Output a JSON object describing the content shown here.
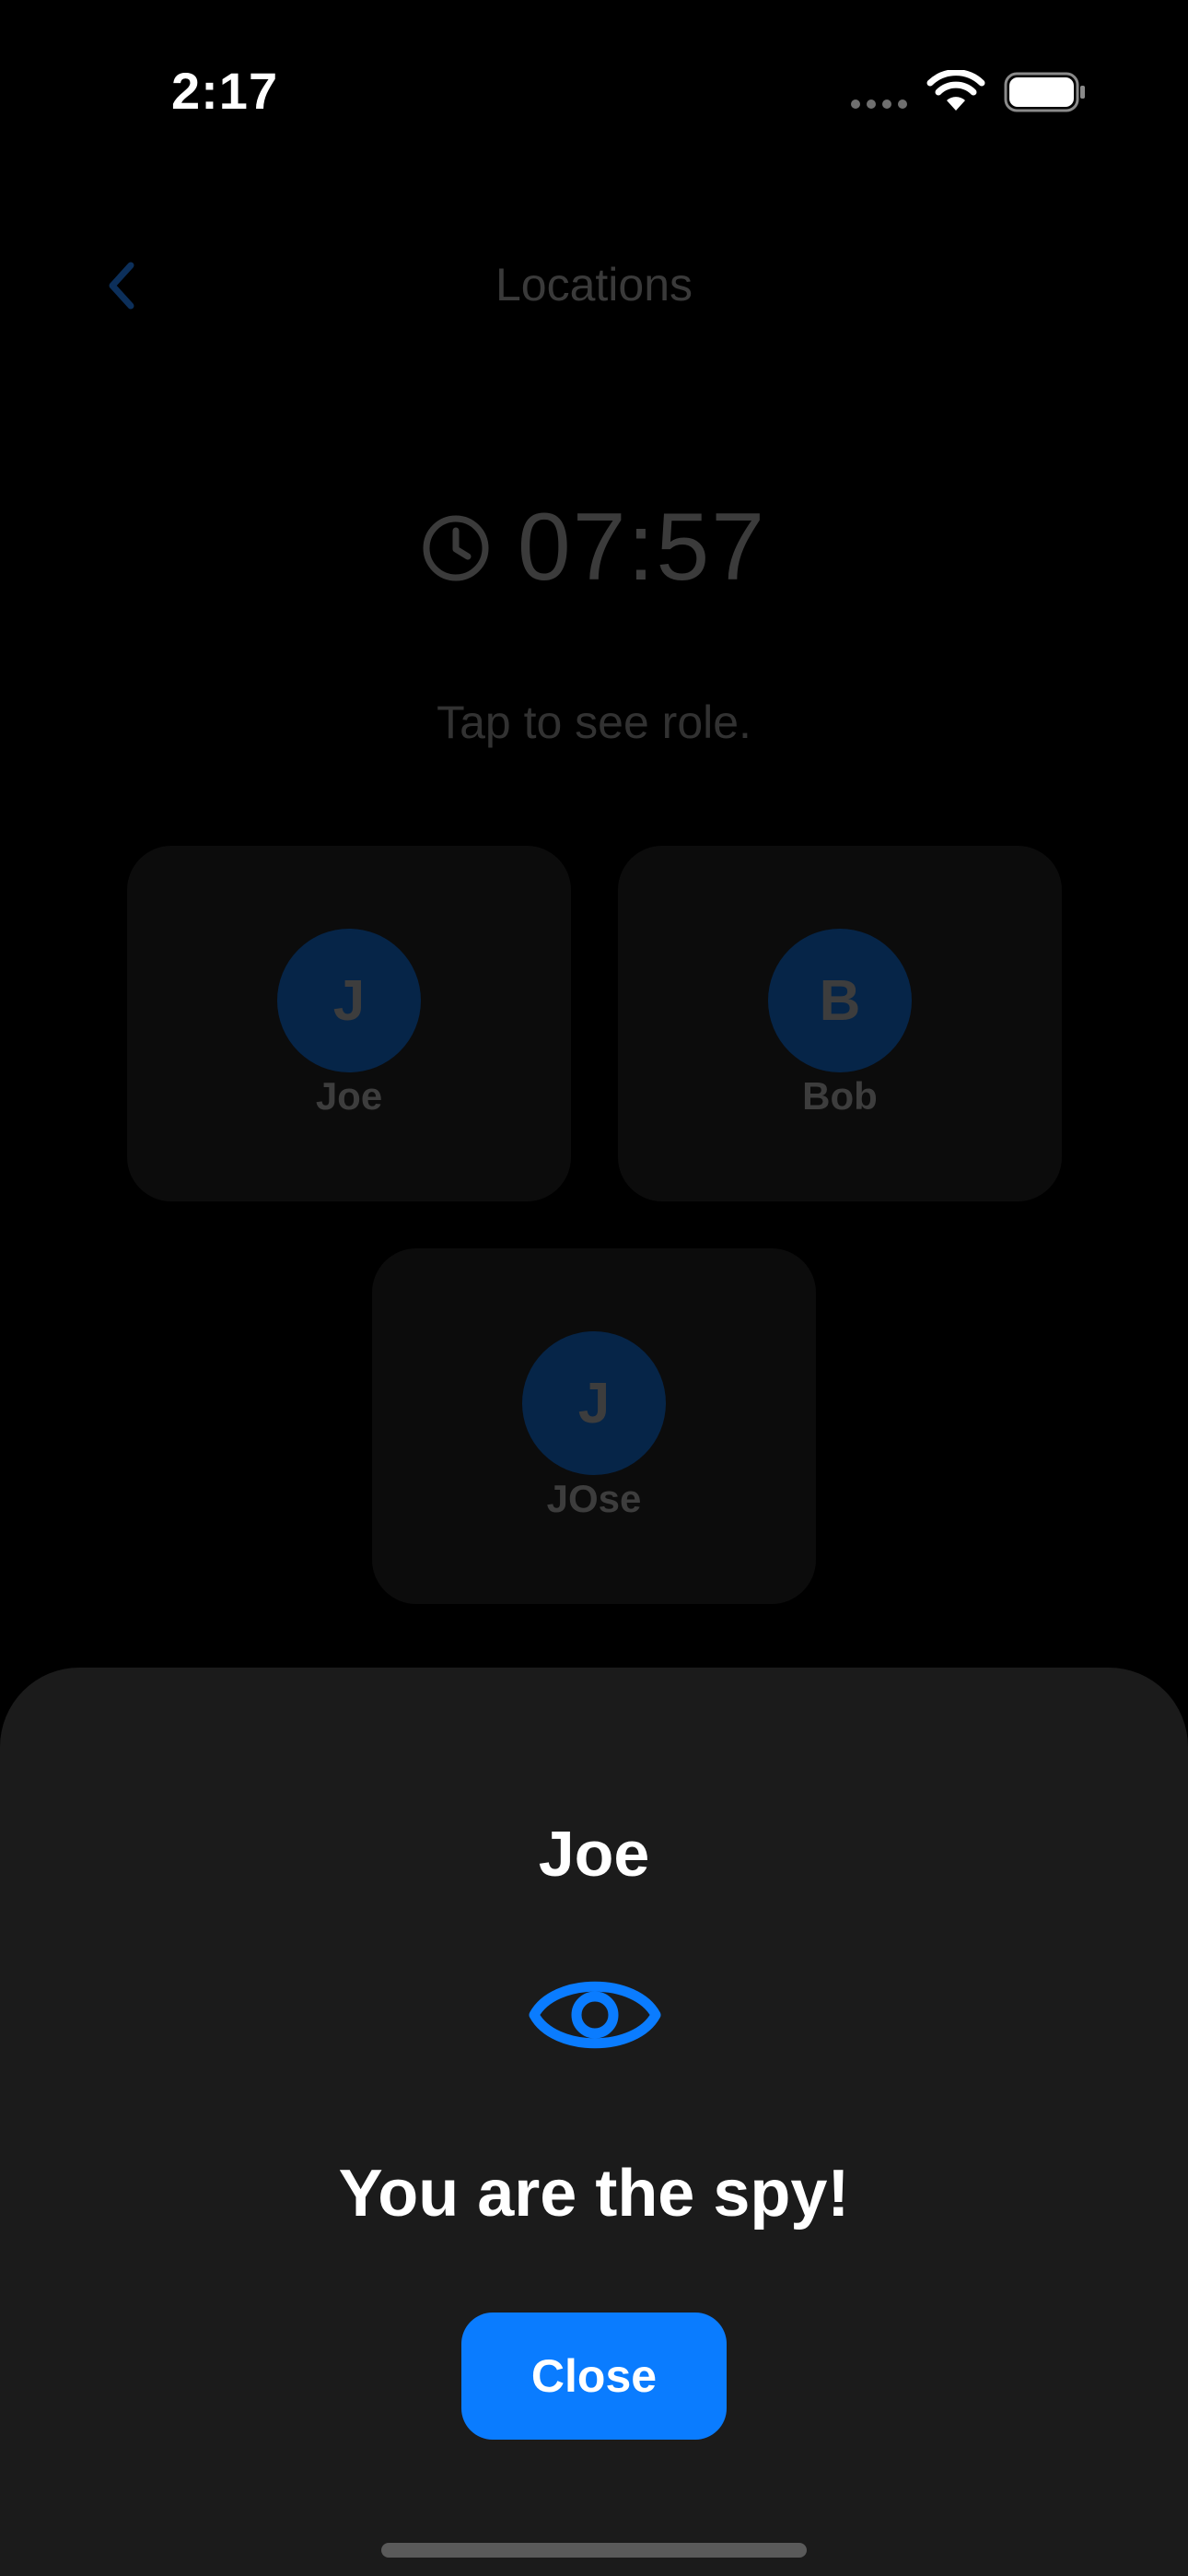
{
  "status_bar": {
    "time": "2:17"
  },
  "nav": {
    "title": "Locations",
    "back_icon": "chevron-left-icon"
  },
  "timer": {
    "icon": "clock-icon",
    "value": "07:57"
  },
  "hint": "Tap to see role.",
  "players": [
    {
      "initial": "J",
      "name": "Joe"
    },
    {
      "initial": "B",
      "name": "Bob"
    },
    {
      "initial": "J",
      "name": "JOse"
    }
  ],
  "sheet": {
    "player_name": "Joe",
    "role_icon": "eye-icon",
    "role_text": "You are the spy!",
    "close_label": "Close"
  },
  "colors": {
    "accent": "#0a7cff",
    "sheet_bg": "#1b1b1b",
    "background": "#000000"
  }
}
